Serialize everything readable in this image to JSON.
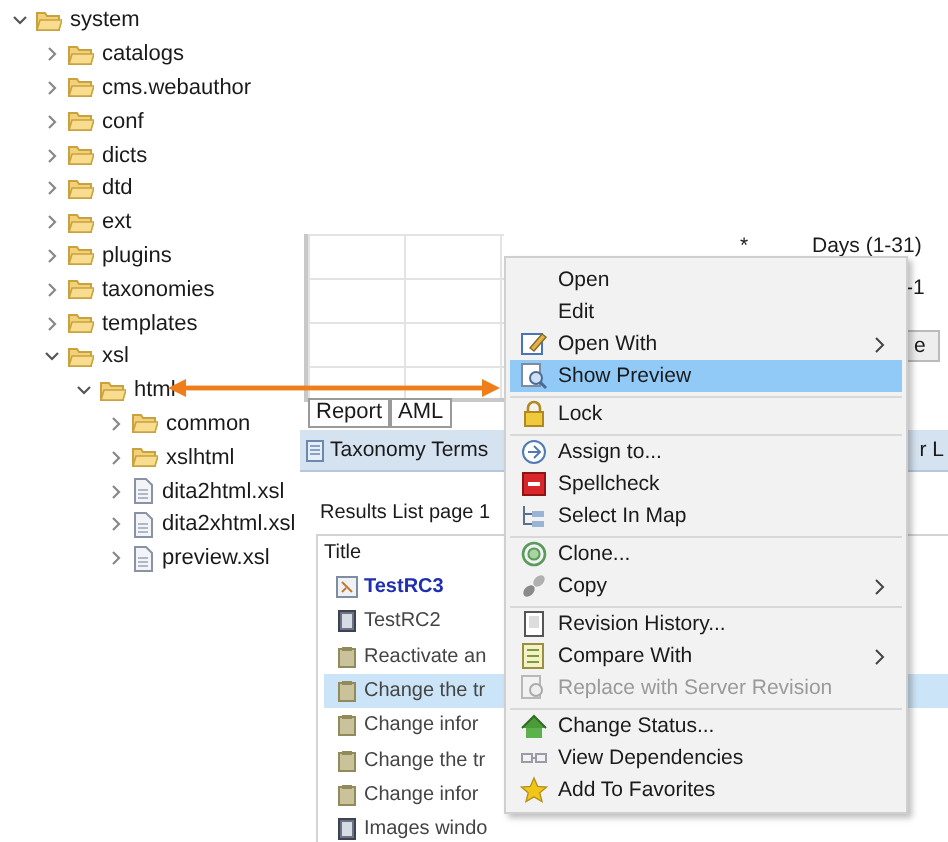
{
  "tree": [
    {
      "label": "system",
      "kind": "folder",
      "expanded": true,
      "children": [
        {
          "label": "catalogs",
          "kind": "folder",
          "expanded": false
        },
        {
          "label": "cms.webauthor",
          "kind": "folder",
          "expanded": false
        },
        {
          "label": "conf",
          "kind": "folder",
          "expanded": false
        },
        {
          "label": "dicts",
          "kind": "folder",
          "expanded": false
        },
        {
          "label": "dtd",
          "kind": "folder",
          "expanded": false
        },
        {
          "label": "ext",
          "kind": "folder",
          "expanded": false
        },
        {
          "label": "plugins",
          "kind": "folder",
          "expanded": false
        },
        {
          "label": "taxonomies",
          "kind": "folder",
          "expanded": false
        },
        {
          "label": "templates",
          "kind": "folder",
          "expanded": false
        },
        {
          "label": "xsl",
          "kind": "folder",
          "expanded": true,
          "children": [
            {
              "label": "html",
              "kind": "folder",
              "expanded": true,
              "children": [
                {
                  "label": "common",
                  "kind": "folder",
                  "expanded": false
                },
                {
                  "label": "xslhtml",
                  "kind": "folder",
                  "expanded": false
                },
                {
                  "label": "dita2html.xsl",
                  "kind": "file",
                  "expanded": false
                },
                {
                  "label": "dita2xhtml.xsl",
                  "kind": "file",
                  "expanded": false
                },
                {
                  "label": "preview.xsl",
                  "kind": "file",
                  "expanded": false
                }
              ]
            }
          ]
        }
      ]
    }
  ],
  "schedule_panel": {
    "column_1": "*",
    "column_2": "Days (1-31)",
    "column_2_next": "-1",
    "button_cut": "e"
  },
  "report_tabs": [
    {
      "label": "Report"
    },
    {
      "label": "AML"
    }
  ],
  "view_tabs": [
    {
      "label": "Taxonomy Terms"
    },
    {
      "label": "r L"
    }
  ],
  "results": {
    "title": "Results List page 1",
    "column": "Title",
    "rows": [
      {
        "label": "TestRC3",
        "kind": "map",
        "bold": true,
        "selected": false
      },
      {
        "label": "TestRC2",
        "kind": "book",
        "bold": false,
        "selected": false
      },
      {
        "label": "Reactivate an",
        "kind": "topic",
        "bold": false,
        "selected": false
      },
      {
        "label": "Change the tr",
        "kind": "topic",
        "bold": false,
        "selected": true
      },
      {
        "label": "Change infor",
        "kind": "topic",
        "bold": false,
        "selected": false
      },
      {
        "label": "Change the tr",
        "kind": "topic",
        "bold": false,
        "selected": false
      },
      {
        "label": "Change infor",
        "kind": "topic",
        "bold": false,
        "selected": false
      },
      {
        "label": "Images windo",
        "kind": "book",
        "bold": false,
        "selected": false
      }
    ]
  },
  "context_menu": [
    {
      "label": "Open",
      "submenu": false,
      "selected": false,
      "disabled": false,
      "separator_before": false
    },
    {
      "label": "Edit",
      "submenu": false,
      "selected": false,
      "disabled": false,
      "separator_before": false
    },
    {
      "label": "Open With",
      "submenu": true,
      "selected": false,
      "disabled": false,
      "separator_before": false
    },
    {
      "label": "Show Preview",
      "submenu": false,
      "selected": true,
      "disabled": false,
      "separator_before": false
    },
    {
      "label": "Lock",
      "submenu": false,
      "selected": false,
      "disabled": false,
      "separator_before": true
    },
    {
      "label": "Assign to...",
      "submenu": false,
      "selected": false,
      "disabled": false,
      "separator_before": true
    },
    {
      "label": "Spellcheck",
      "submenu": false,
      "selected": false,
      "disabled": false,
      "separator_before": false
    },
    {
      "label": "Select In Map",
      "submenu": false,
      "selected": false,
      "disabled": false,
      "separator_before": false
    },
    {
      "label": "Clone...",
      "submenu": false,
      "selected": false,
      "disabled": false,
      "separator_before": true
    },
    {
      "label": "Copy",
      "submenu": true,
      "selected": false,
      "disabled": false,
      "separator_before": false
    },
    {
      "label": "Revision History...",
      "submenu": false,
      "selected": false,
      "disabled": false,
      "separator_before": true
    },
    {
      "label": "Compare With",
      "submenu": true,
      "selected": false,
      "disabled": false,
      "separator_before": false
    },
    {
      "label": "Replace with Server Revision",
      "submenu": false,
      "selected": false,
      "disabled": true,
      "separator_before": false
    },
    {
      "label": "Change Status...",
      "submenu": false,
      "selected": false,
      "disabled": false,
      "separator_before": true
    },
    {
      "label": "View Dependencies",
      "submenu": false,
      "selected": false,
      "disabled": false,
      "separator_before": false
    },
    {
      "label": "Add To Favorites",
      "submenu": false,
      "selected": false,
      "disabled": false,
      "separator_before": false
    }
  ]
}
